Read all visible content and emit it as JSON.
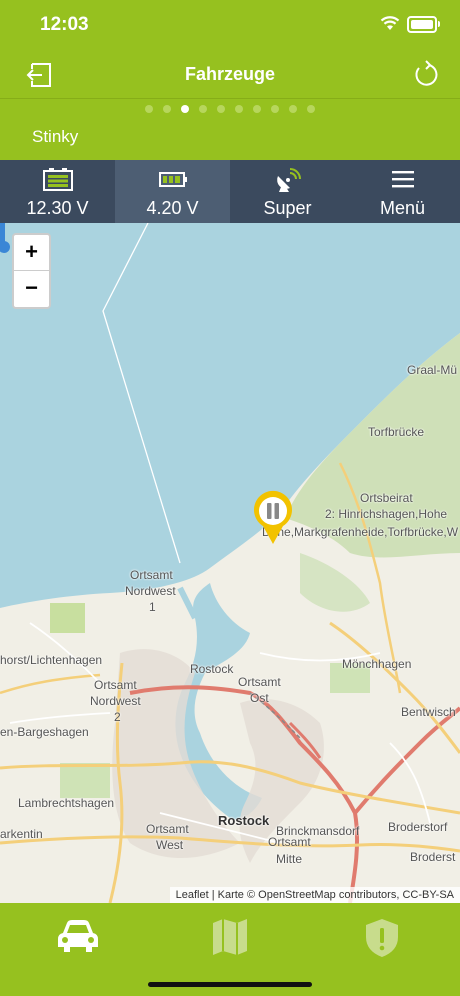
{
  "status_bar": {
    "time": "12:03"
  },
  "header": {
    "title": "Fahrzeuge"
  },
  "pager": {
    "count": 10,
    "active_index": 2
  },
  "vehicle": {
    "name": "Stinky"
  },
  "stats": [
    {
      "icon": "car-battery-icon",
      "value": "12.30 V"
    },
    {
      "icon": "battery-icon",
      "value": "4.20 V"
    },
    {
      "icon": "satellite-dish-icon",
      "value": "Super"
    },
    {
      "icon": "hamburger-menu-icon",
      "value": "Menü"
    }
  ],
  "map": {
    "zoom_in": "+",
    "zoom_out": "−",
    "attribution": "Leaflet | Karte © OpenStreetMap contributors, CC-BY-SA",
    "labels": [
      "Graal-Mü",
      "Torfbrücke",
      "Ortsbeirat",
      "2: Hinrichshagen,Hohe",
      "Düne,Markgrafenheide,Torfbrücke,W",
      "Ortsamt",
      "Nordwest",
      "1",
      "horst/Lichtenhagen",
      "Rostock",
      "Mönchhagen",
      "Ortsamt",
      "Ost",
      "Ortsamt",
      "Nordwest",
      "2",
      "Bentwisch",
      "en-Bargeshagen",
      "Lambrechtshagen",
      "Rostock",
      "Brinckmansdorf",
      "Broderstorf",
      "arkentin",
      "Ortsamt",
      "West",
      "Ortsamt",
      "Mitte",
      "Broderst"
    ]
  },
  "tabbar": {
    "tabs": [
      {
        "icon": "car-icon",
        "active": true
      },
      {
        "icon": "map-icon",
        "active": false
      },
      {
        "icon": "alert-shield-icon",
        "active": false
      }
    ]
  },
  "colors": {
    "brand_green": "#96c11f",
    "stats_bar": "#3b4a5e",
    "water": "#aad3df",
    "pin": "#f2c200"
  }
}
